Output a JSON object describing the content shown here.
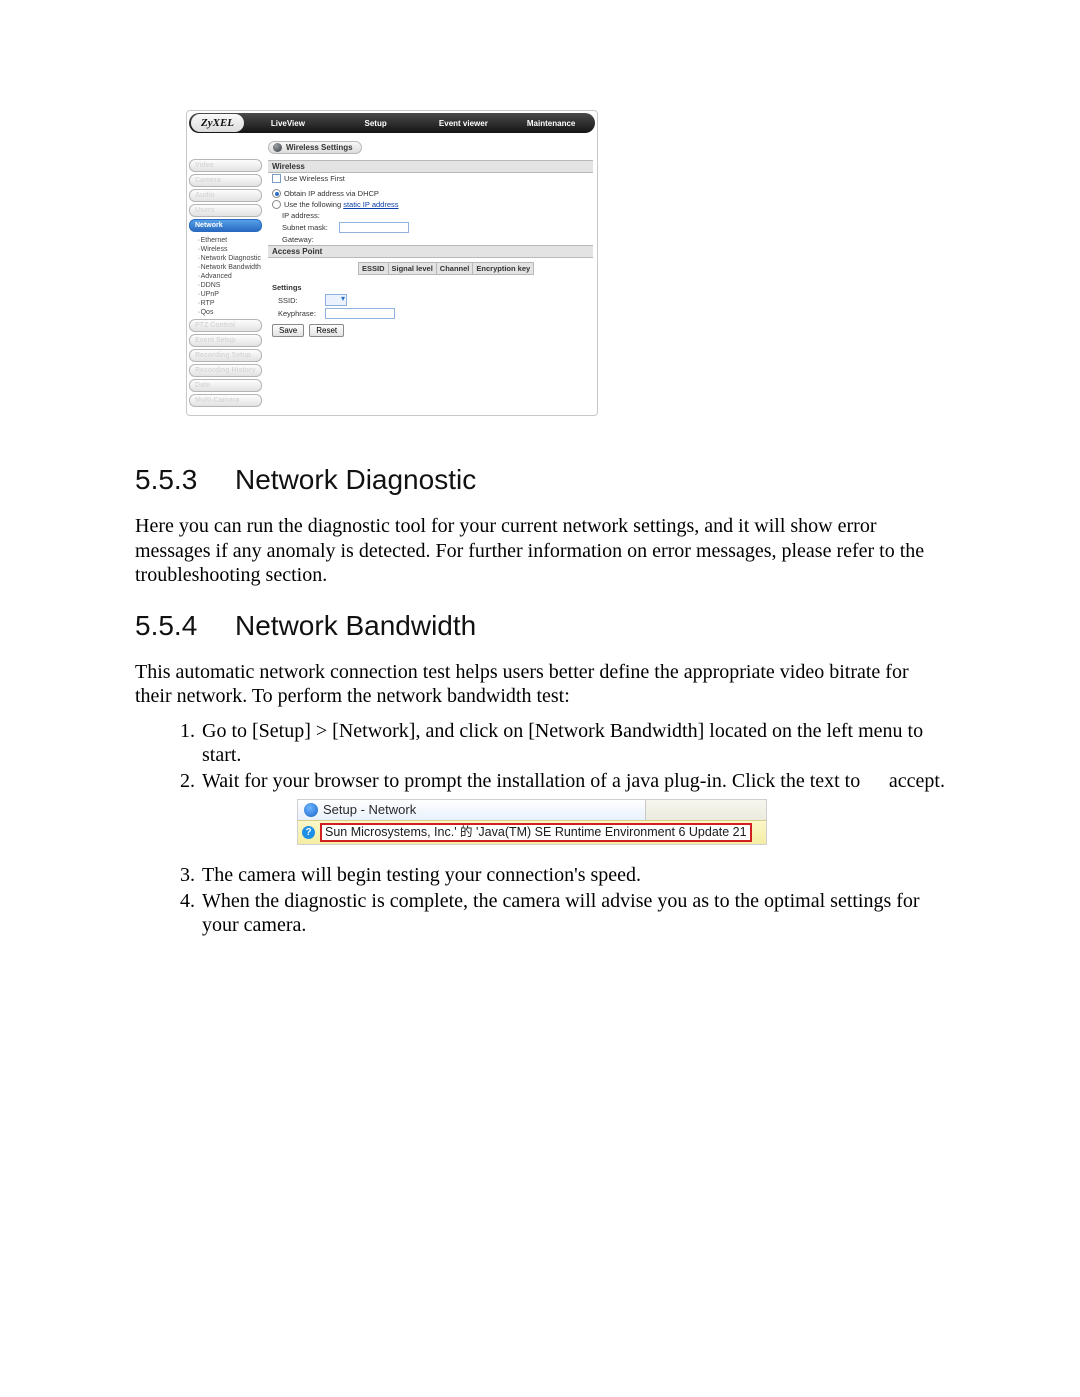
{
  "shot": {
    "brand": "ZyXEL",
    "nav": [
      "LiveView",
      "Setup",
      "Event viewer",
      "Maintenance"
    ],
    "sidebar_top": [
      "Video",
      "Camera",
      "Audio",
      "Users"
    ],
    "sidebar_active": "Network",
    "sidebar_sub": [
      "Ethernet",
      "Wireless",
      "Network Diagnostic",
      "Network Bandwidth",
      "Advanced",
      "DDNS",
      "UPnP",
      "RTP",
      "Qos"
    ],
    "sidebar_bot": [
      "PTZ Control",
      "Event Setup",
      "Recording Setup",
      "Recording History",
      "Date",
      "Multi-Camera"
    ],
    "page_title": "Wireless Settings",
    "h_wireless": "Wireless",
    "use_first": "Use Wireless First",
    "dhcp": "Obtain IP address via DHCP",
    "static_pre": "Use the following ",
    "static_link": "static IP address",
    "ip_label": "IP address:",
    "mask_label": "Subnet mask:",
    "gw_label": "Gateway:",
    "h_ap": "Access Point",
    "ap_cols": [
      "ESSID",
      "Signal level",
      "Channel",
      "Encryption key"
    ],
    "h_settings": "Settings",
    "ssid_label": "SSID:",
    "key_label": "Keyphrase:",
    "save": "Save",
    "reset": "Reset"
  },
  "doc": {
    "s1_num": "5.5.3",
    "s1_title": "Network Diagnostic",
    "s1_p": "Here you can run the diagnostic tool for your current network settings, and it will show error messages if any anomaly is detected. For further information on error messages, please refer to the troubleshooting section.",
    "s2_num": "5.5.4",
    "s2_title": "Network Bandwidth",
    "s2_p": "This automatic network connection test helps users better define the appropriate video bitrate for their network. To perform the network bandwidth test:",
    "step1": "Go to [Setup] > [Network], and click on [Network Bandwidth] located on the left menu to start.",
    "step2": "Wait for your browser to prompt the installation of a java plug-in. Click the text to ",
    "step2_tail": "accept.",
    "step3": "The camera will begin testing your connection's speed.",
    "step4": "When the diagnostic is complete, the camera will advise you as to the optimal settings for your camera."
  },
  "java": {
    "tab": "Setup - Network",
    "msg": "Sun Microsystems, Inc.' 的 'Java(TM) SE Runtime Environment 6 Update 21"
  }
}
